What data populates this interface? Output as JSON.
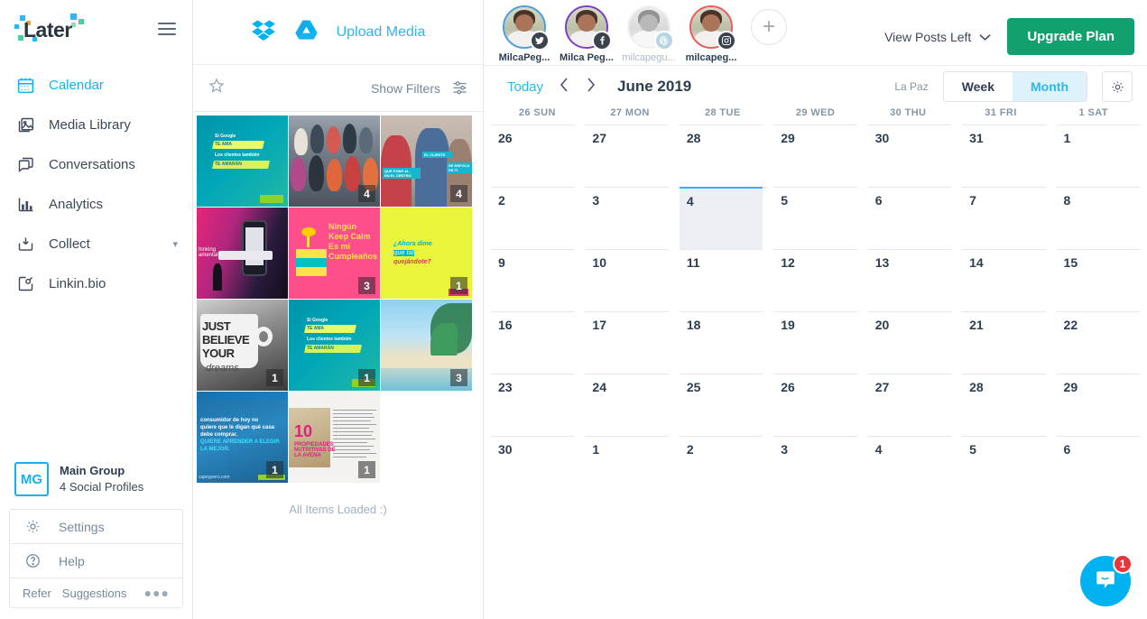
{
  "brand": {
    "name": "Later",
    "accent": "#11b3ee",
    "green": "#13a06f"
  },
  "sidebar": {
    "menu_icon": "hamburger-icon",
    "items": [
      {
        "label": "Calendar",
        "icon": "calendar-icon",
        "active": true
      },
      {
        "label": "Media Library",
        "icon": "image-stack-icon",
        "active": false
      },
      {
        "label": "Conversations",
        "icon": "chat-bubble-icon",
        "active": false
      },
      {
        "label": "Analytics",
        "icon": "bar-chart-icon",
        "active": false
      },
      {
        "label": "Collect",
        "icon": "inbox-download-icon",
        "active": false,
        "chevron": "chevron-down-icon"
      },
      {
        "label": "Linkin.bio",
        "icon": "link-square-icon",
        "active": false
      }
    ],
    "group": {
      "initials": "MG",
      "name": "Main Group",
      "subtitle": "4 Social Profiles"
    },
    "settings_label": "Settings",
    "settings_icon": "gear-icon",
    "help_label": "Help",
    "help_icon": "question-circle-icon",
    "refer_label": "Refer",
    "suggestions_label": "Suggestions",
    "more_icon": "ellipsis-icon"
  },
  "media": {
    "dropbox_icon": "dropbox-icon",
    "gdrive_icon": "google-drive-icon",
    "upload_label": "Upload Media",
    "star_icon": "star-icon",
    "filters_label": "Show Filters",
    "filters_icon": "sliders-icon",
    "all_loaded": "All Items Loaded :)",
    "thumbs": [
      {
        "art": "t-teal",
        "badge": "",
        "alt": "Si Google TE AMA Los clientes tambien TE AMARAN"
      },
      {
        "art": "t-group",
        "badge": "4",
        "alt": "Group photo of people"
      },
      {
        "art": "t-street",
        "badge": "4",
        "alt": "Street people with EL CLIENTE tags"
      },
      {
        "art": "t-phone",
        "badge": "",
        "alt": "Speaker on stage with phone screen"
      },
      {
        "art": "t-cake",
        "badge": "3",
        "alt": "Ningun Keep Calm Es mi Cumpleanos"
      },
      {
        "art": "t-yellow",
        "badge": "1",
        "alt": "Ahora dime que quejandote"
      },
      {
        "art": "t-mug",
        "badge": "1",
        "alt": "JUST BELIEVE YOUR dreams mug"
      },
      {
        "art": "t-teal",
        "badge": "1",
        "alt": "Si Google TE AMA"
      },
      {
        "art": "t-beach",
        "badge": "3",
        "alt": "Tropical beach with palm trees"
      },
      {
        "art": "t-blue",
        "badge": "1",
        "alt": "consumidor de hoy no quiere que le digan que casa debe comprar"
      },
      {
        "art": "t-doc",
        "badge": "1",
        "alt": "10 propiedades nutritivas de LA AVENA"
      }
    ],
    "cake_text": "Ningún\nKeep Calm\nEs mi\nCumpleaños",
    "yellow_text": "¿Ahora dime\nque quejandote?",
    "mug_text": "JUST\nBELIEVE\nYOUR",
    "blue_text": "consumidor de hoy no\nquiere que le digan qué casa\ndebe comprar.\nQUIERE APRENDER A ELEGIR\nLA MEJOR.",
    "doc_number": "10"
  },
  "topbar": {
    "profiles": [
      {
        "name": "MilcaPeg...",
        "network": "twitter",
        "ring": "#4a9fe0",
        "active": true
      },
      {
        "name": "Milca Peg...",
        "network": "facebook",
        "ring": "#7b3fbf",
        "active": true
      },
      {
        "name": "milcapegu...",
        "network": "pinterest",
        "ring": "#d8dde2",
        "active": false
      },
      {
        "name": "milcapeg...",
        "network": "instagram",
        "ring": "#ef5a5a",
        "active": true
      }
    ],
    "add_profile_icon": "plus-icon",
    "posts_left_label": "View Posts Left",
    "posts_left_icon": "chevron-down-icon",
    "upgrade_label": "Upgrade Plan"
  },
  "calendar": {
    "today_label": "Today",
    "prev_icon": "chevron-left-icon",
    "next_icon": "chevron-right-icon",
    "month_label": "June 2019",
    "timezone": "La Paz",
    "view_week": "Week",
    "view_month": "Month",
    "active_view": "Month",
    "settings_icon": "gear-icon",
    "day_headers": [
      "26 SUN",
      "27 MON",
      "28 TUE",
      "29 WED",
      "30 THU",
      "31 FRI",
      "1 SAT"
    ],
    "weeks": [
      [
        {
          "n": "26"
        },
        {
          "n": "27"
        },
        {
          "n": "28"
        },
        {
          "n": "29"
        },
        {
          "n": "30"
        },
        {
          "n": "31"
        },
        {
          "n": "1"
        }
      ],
      [
        {
          "n": "2"
        },
        {
          "n": "3"
        },
        {
          "n": "4",
          "today": true
        },
        {
          "n": "5"
        },
        {
          "n": "6"
        },
        {
          "n": "7"
        },
        {
          "n": "8"
        }
      ],
      [
        {
          "n": "9"
        },
        {
          "n": "10"
        },
        {
          "n": "11"
        },
        {
          "n": "12"
        },
        {
          "n": "13"
        },
        {
          "n": "14"
        },
        {
          "n": "15"
        }
      ],
      [
        {
          "n": "16"
        },
        {
          "n": "17"
        },
        {
          "n": "18"
        },
        {
          "n": "19"
        },
        {
          "n": "20"
        },
        {
          "n": "21"
        },
        {
          "n": "22"
        }
      ],
      [
        {
          "n": "23"
        },
        {
          "n": "24"
        },
        {
          "n": "25"
        },
        {
          "n": "26"
        },
        {
          "n": "27"
        },
        {
          "n": "28"
        },
        {
          "n": "29"
        }
      ],
      [
        {
          "n": "30"
        },
        {
          "n": "1"
        },
        {
          "n": "2"
        },
        {
          "n": "3"
        },
        {
          "n": "4"
        },
        {
          "n": "5"
        },
        {
          "n": "6"
        }
      ]
    ]
  },
  "chat": {
    "icon": "intercom-chat-icon",
    "badge": "1"
  }
}
